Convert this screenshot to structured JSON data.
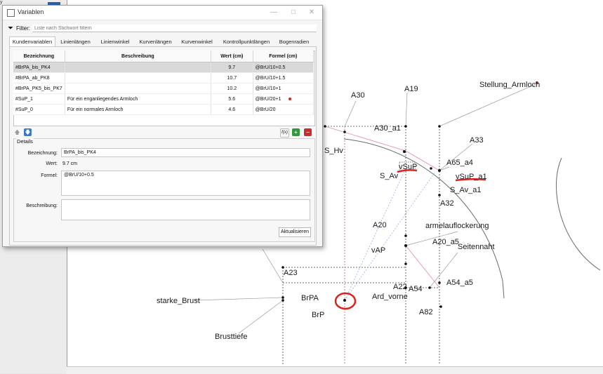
{
  "dialog": {
    "title": "Variablen",
    "filter_label": "Filter:",
    "filter_placeholder": "Liste nach Stichwort filtern",
    "tabs": [
      {
        "label": "Kundenvariablen"
      },
      {
        "label": "Linienlängen"
      },
      {
        "label": "Linienwinkel"
      },
      {
        "label": "Kurvenlängen"
      },
      {
        "label": "Kurvenwinkel"
      },
      {
        "label": "Kontrollpunktlängen"
      },
      {
        "label": "Bogenradien"
      }
    ],
    "active_tab": "Kundenvariablen",
    "table": {
      "columns": [
        "Bezeichnung",
        "Beschreibung",
        "Wert (cm)",
        "Formel (cm)"
      ],
      "rows": [
        {
          "name": "#BrPA_bis_PK4",
          "desc": "",
          "value": "9.7",
          "formula": "@BrU/10+0.5",
          "selected": true,
          "marked": false
        },
        {
          "name": "#BrPA_ab_PK8",
          "desc": "",
          "value": "10.7",
          "formula": "@BrU/10+1.5",
          "selected": false,
          "marked": false
        },
        {
          "name": "#BrPA_PK5_bis_PK7",
          "desc": "",
          "value": "10.2",
          "formula": "@BrU/10+1",
          "selected": false,
          "marked": false
        },
        {
          "name": "#SuP_1",
          "desc": "Für ein enganliegendes Armloch",
          "value": "5.6",
          "formula": "@BrU/20+1",
          "selected": false,
          "marked": true
        },
        {
          "name": "#SuP_0",
          "desc": "Für ein normales Armloch",
          "value": "4.6",
          "formula": "@BrU/20",
          "selected": false,
          "marked": false
        }
      ]
    },
    "details": {
      "legend": "Details",
      "name_label": "Bezeichnung:",
      "name_value": "BrPA_bis_PK4",
      "value_label": "Wert:",
      "value_value": "9.7 cm",
      "formula_label": "Formel:",
      "formula_value": "@BrU/10+0.5",
      "description_label": "Beschreibung:",
      "description_value": "",
      "apply_label": "Aktualisieren"
    },
    "fx_label": "f(x)"
  },
  "drawing": {
    "labels": {
      "stellung_armloch": "Stellung_Armloch",
      "a30": "A30",
      "a19": "A19",
      "a30_a1": "A30_a1",
      "a33": "A33",
      "s_hv": "S_Hv",
      "a65_a4": "A65_a4",
      "vsup": "vSuP",
      "s_av": "S_Av",
      "vsup_a1": "vSuP_a1",
      "s_av_a1": "S_Av_a1",
      "a32": "A32",
      "armelauflockerung": "armelauflockerung",
      "a20": "A20",
      "a20_a5": "A20_a5",
      "seitennaht": "Seitennaht",
      "vap": "vAP",
      "a23": "A23",
      "a22": "A22",
      "a54": "A54",
      "a54_a5": "A54_a5",
      "brpa": "BrPA",
      "starke_brust": "starke_Brust",
      "ard_vorne": "Ard_vorne",
      "a82": "A82",
      "brp": "BrP",
      "brusttiefe": "Brusttiefe"
    },
    "colors": {
      "annotation_red": "#e0201c",
      "line_black": "#1a1a1a",
      "guide_pink": "#e8899a",
      "guide_blue": "#8aa3e0"
    }
  }
}
